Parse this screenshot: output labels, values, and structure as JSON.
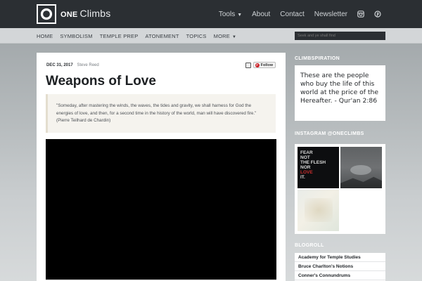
{
  "brand": {
    "one": "ONE",
    "climbs": "Climbs"
  },
  "topnav": {
    "items": [
      {
        "label": "Tools",
        "dropdown": true
      },
      {
        "label": "About"
      },
      {
        "label": "Contact"
      },
      {
        "label": "Newsletter"
      }
    ],
    "icons": [
      "instagram-icon",
      "pinterest-icon"
    ]
  },
  "subnav": {
    "items": [
      "HOME",
      "SYMBOLISM",
      "TEMPLE PREP",
      "ATONEMENT",
      "TOPICS",
      "MORE"
    ]
  },
  "search": {
    "placeholder": "Seek and ye shall find"
  },
  "article": {
    "date": "DEC 31, 2017",
    "author": "Steve Reed",
    "follow_label": "Follow",
    "title": "Weapons of Love",
    "quote": "\"Someday, after mastering the winds, the waves, the tides and gravity, we shall harness for God the energies of love, and then, for a second time in the history of the world, man will have discovered fire.\" (Pierre Teilhard de Chardin)"
  },
  "sidebar": {
    "climbspiration_heading": "CLIMBSPIRATION",
    "climbspiration_text": "These are the people who buy the life of this world at the price of the Hereafter. - Qur'an 2:86",
    "instagram_heading": "INSTAGRAM @ONECLIMBS",
    "instagram_thumb1": {
      "line1": "FEAR",
      "line2": "NOT",
      "line3": "THE FLESH",
      "line4": "NOR",
      "line5": "LOVE",
      "line6": "IT."
    },
    "blogroll_heading": "BLOGROLL",
    "blogroll": [
      "Academy for Temple Studies",
      "Bruce Charlton's Notions",
      "Conner's Connundrums"
    ]
  },
  "colors": {
    "topbar": "#2b2f33",
    "subbar": "#d3d6d8",
    "follow_badge": "#cb2027"
  }
}
